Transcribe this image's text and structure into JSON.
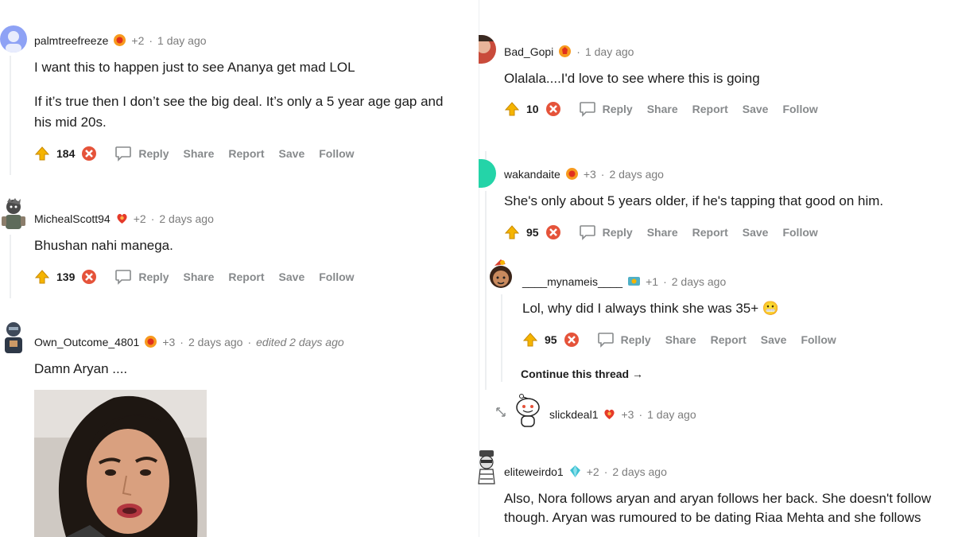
{
  "left": {
    "comments": [
      {
        "username": "palmtreefreeze",
        "karma": "+2",
        "dot": "·",
        "time": "1 day ago",
        "lines": [
          "I want this to happen just to see Ananya get mad LOL",
          "If it’s true then I don’t see the big deal. It’s only a 5 year age gap and",
          "his mid 20s."
        ],
        "votes": "184"
      },
      {
        "username": "MichealScott94",
        "karma": "+2",
        "dot": "·",
        "time": "2 days ago",
        "lines": [
          "Bhushan nahi manega."
        ],
        "votes": "139"
      },
      {
        "username": "Own_Outcome_4801",
        "karma": "+3",
        "dot": "·",
        "time": "2 days ago",
        "dot2": "·",
        "edited": "edited 2 days ago",
        "lines": [
          "Damn Aryan ...."
        ]
      }
    ]
  },
  "right": {
    "comments": [
      {
        "username": "Bad_Gopi",
        "dot": "·",
        "time": "1 day ago",
        "lines": [
          "Olalala....I'd love to see where this is going"
        ],
        "votes": "10"
      },
      {
        "username": "wakandaite",
        "karma": "+3",
        "dot": "·",
        "time": "2 days ago",
        "lines": [
          "She's only about 5 years older, if he's tapping that good on him."
        ],
        "votes": "95"
      },
      {
        "username": "____mynameis____",
        "karma": "+1",
        "dot": "·",
        "time": "2 days ago",
        "lines": [
          "Lol, why did I always think she was 35+ 😬"
        ],
        "votes": "95",
        "continue": "Continue this thread →"
      },
      {
        "username": "slickdeal1",
        "karma": "+3",
        "dot": "·",
        "time": "1 day ago"
      },
      {
        "username": "eliteweirdo1",
        "karma": "+2",
        "dot": "·",
        "time": "2 days ago",
        "lines": [
          "Also, Nora follows aryan and aryan follows her back. She doesn't follow",
          "though. Aryan was rumoured to be dating Riaa Mehta and she follows"
        ]
      }
    ]
  },
  "actions": {
    "reply": "Reply",
    "share": "Share",
    "report": "Report",
    "save": "Save",
    "follow": "Follow"
  },
  "colors": {
    "upvote": "#f5b400",
    "downvote": "#e5533a",
    "muted": "#878a8c",
    "text": "#1c1c1c"
  }
}
